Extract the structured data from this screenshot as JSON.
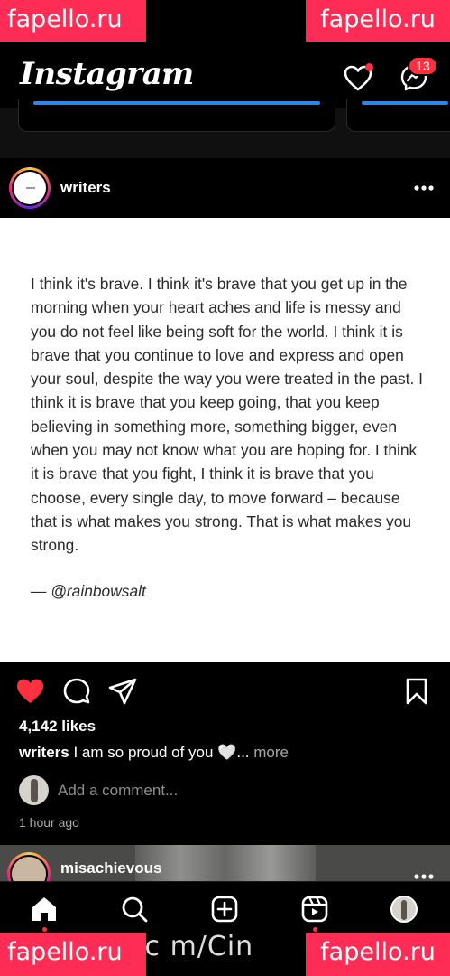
{
  "watermarks": {
    "top_left": "fapello.ru",
    "top_right": "fapello.ru",
    "bottom_left": "fapello.ru",
    "bottom_right": "fapello.ru",
    "bottom_middle": ".c m/Cin"
  },
  "header": {
    "logo": "Instagram",
    "message_badge": "13",
    "icons": [
      "chevron-down-icon",
      "heart-icon",
      "messenger-icon"
    ]
  },
  "post": {
    "username": "writers",
    "quote": "I think it's brave. I think it's brave that you get up in the morning when your heart aches and life is messy and you do not feel like being soft for the world. I think it is brave that you continue to love and express and open your soul, despite the way you were treated in the past. I think it is brave that you keep going, that you keep believing in something more, something bigger, even when you may not know what you are hoping for. I think it is brave that you fight, I think it is brave that you choose, every single day, to move forward – because that is what makes you strong. That is what makes you strong.",
    "quote_author": "— @rainbowsalt",
    "likes": "4,142 likes",
    "caption_user": "writers",
    "caption_text": "I am so proud of you 🤍...",
    "caption_more": "more",
    "comment_placeholder": "Add a comment...",
    "timestamp": "1 hour ago",
    "liked": true
  },
  "next_post": {
    "username": "misachievous"
  },
  "tabbar": {
    "icons": [
      "home-icon",
      "search-icon",
      "create-icon",
      "reels-icon",
      "profile-avatar"
    ]
  },
  "colors": {
    "accent_red": "#ff3040",
    "story_blue": "#2e86e6",
    "watermark_pink": "#ff2d55"
  }
}
